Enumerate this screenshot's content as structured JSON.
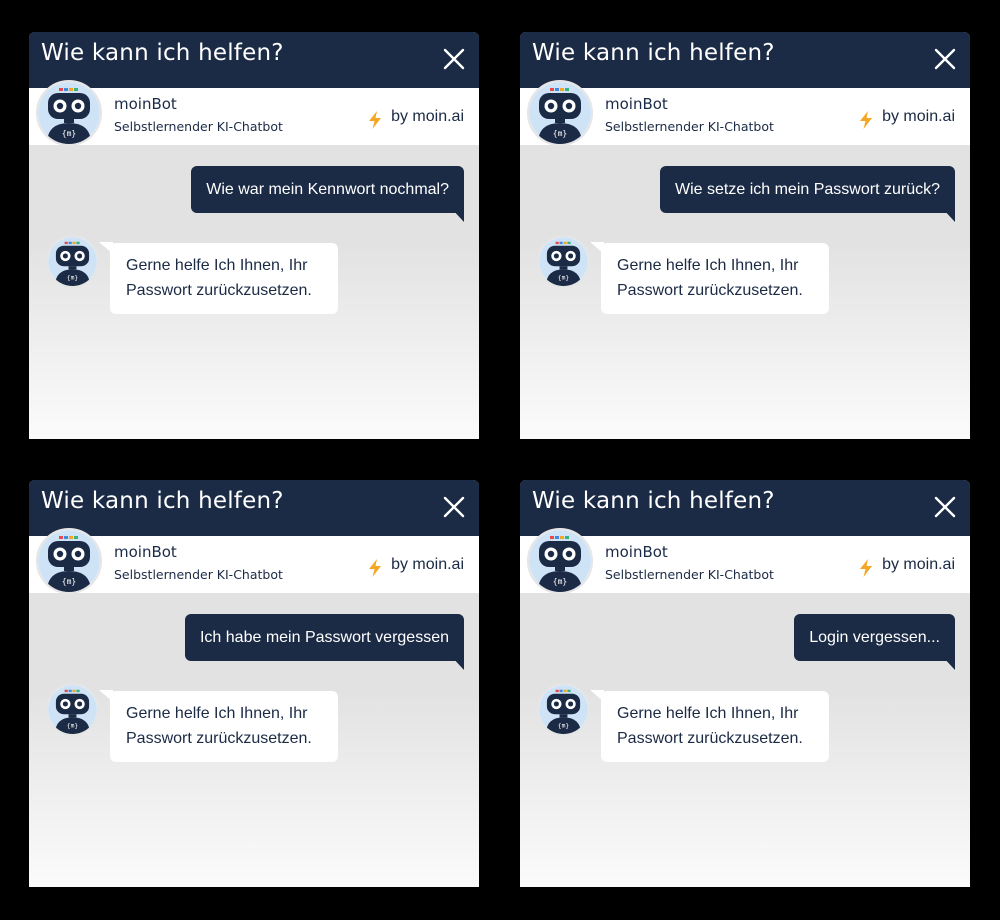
{
  "colors": {
    "navy": "#1b2a45",
    "accent_bolt": "#f5a623",
    "chat_bg": "#e2e2e2",
    "bubble_bot": "#ffffff"
  },
  "widgets": [
    {
      "header": {
        "title": "Wie kann ich helfen?",
        "close_icon": "close-icon"
      },
      "bot": {
        "name": "moinBot",
        "subtitle": "Selbstlernender KI-Chatbot",
        "branding": "by moin.ai",
        "bolt_icon": "lightning-bolt-icon"
      },
      "user_message": "Wie war mein Kennwort nochmal?",
      "bot_message": "Gerne helfe Ich Ihnen, Ihr Passwort zurückzusetzen."
    },
    {
      "header": {
        "title": "Wie kann ich helfen?",
        "close_icon": "close-icon"
      },
      "bot": {
        "name": "moinBot",
        "subtitle": "Selbstlernender KI-Chatbot",
        "branding": "by moin.ai",
        "bolt_icon": "lightning-bolt-icon"
      },
      "user_message": "Wie setze ich mein Passwort zurück?",
      "bot_message": "Gerne helfe Ich Ihnen, Ihr Passwort zurückzusetzen."
    },
    {
      "header": {
        "title": "Wie kann ich helfen?",
        "close_icon": "close-icon"
      },
      "bot": {
        "name": "moinBot",
        "subtitle": "Selbstlernender KI-Chatbot",
        "branding": "by moin.ai",
        "bolt_icon": "lightning-bolt-icon"
      },
      "user_message": "Ich habe mein Passwort vergessen",
      "bot_message": "Gerne helfe Ich Ihnen, Ihr Passwort zurückzusetzen."
    },
    {
      "header": {
        "title": "Wie kann ich helfen?",
        "close_icon": "close-icon"
      },
      "bot": {
        "name": "moinBot",
        "subtitle": "Selbstlernender KI-Chatbot",
        "branding": "by moin.ai",
        "bolt_icon": "lightning-bolt-icon"
      },
      "user_message": "Login vergessen...",
      "bot_message": "Gerne helfe Ich Ihnen, Ihr Passwort zurückzusetzen."
    }
  ]
}
